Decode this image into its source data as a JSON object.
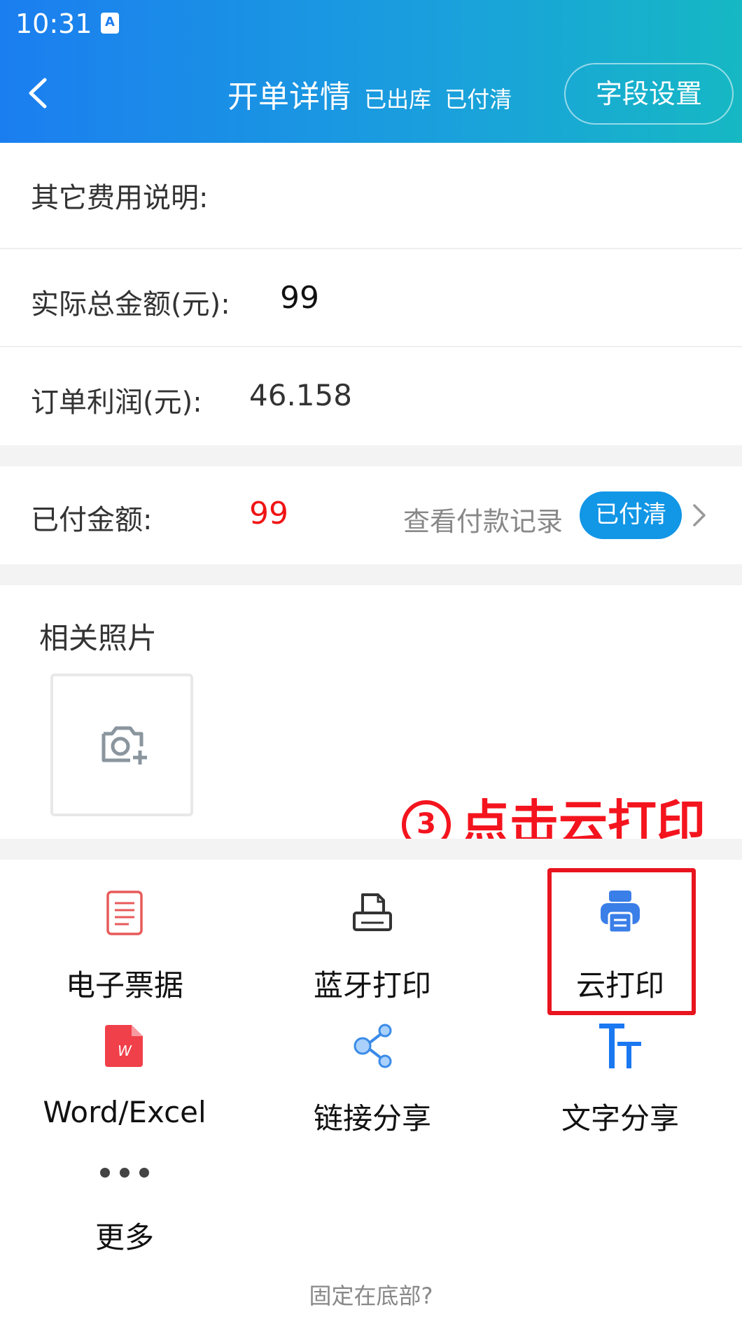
{
  "status_bar": {
    "time": "10:31",
    "notification_icon": "A"
  },
  "header": {
    "title": "开单详情",
    "status_shipped": "已出库",
    "status_paid": "已付清",
    "field_settings": "字段设置"
  },
  "rows": {
    "other_fees_label": "其它费用说明:",
    "actual_total_label": "实际总金额(元):",
    "actual_total_value": "99",
    "profit_label": "订单利润(元):",
    "profit_value": "46.158"
  },
  "payment": {
    "paid_label": "已付金额:",
    "paid_value": "99",
    "record_link": "查看付款记录",
    "badge": "已付清"
  },
  "photos": {
    "label": "相关照片"
  },
  "annotation": {
    "num": "3",
    "text": "点击云打印"
  },
  "actions": [
    {
      "label": "电子票据",
      "icon": "receipt-icon"
    },
    {
      "label": "蓝牙打印",
      "icon": "printer-icon"
    },
    {
      "label": "云打印",
      "icon": "cloud-printer-icon"
    },
    {
      "label": "Word/Excel",
      "icon": "wps-document-icon"
    },
    {
      "label": "链接分享",
      "icon": "share-icon"
    },
    {
      "label": "文字分享",
      "icon": "text-size-icon"
    },
    {
      "label": "更多",
      "icon": "more-icon"
    }
  ],
  "footer": {
    "text": "固定在底部?"
  },
  "colors": {
    "accent": "#1296e6",
    "red": "#f01414"
  }
}
